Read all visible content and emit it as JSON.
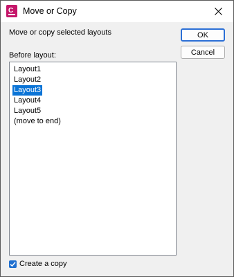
{
  "window": {
    "title": "Move or Copy"
  },
  "dialog": {
    "description": "Move or copy selected layouts",
    "ok_label": "OK",
    "cancel_label": "Cancel",
    "before_layout_label": "Before layout:",
    "layouts": [
      "Layout1",
      "Layout2",
      "Layout3",
      "Layout4",
      "Layout5",
      "(move to end)"
    ],
    "selected_layout": "Layout3",
    "create_copy_label": "Create a copy",
    "create_copy_checked": true
  },
  "colors": {
    "selection": "#0b74d6",
    "app_icon": "#c5166a",
    "checkbox": "#1f6fcf"
  },
  "icons": {
    "app": "autocad-app-icon",
    "close": "close-icon",
    "check": "checkmark-icon"
  }
}
